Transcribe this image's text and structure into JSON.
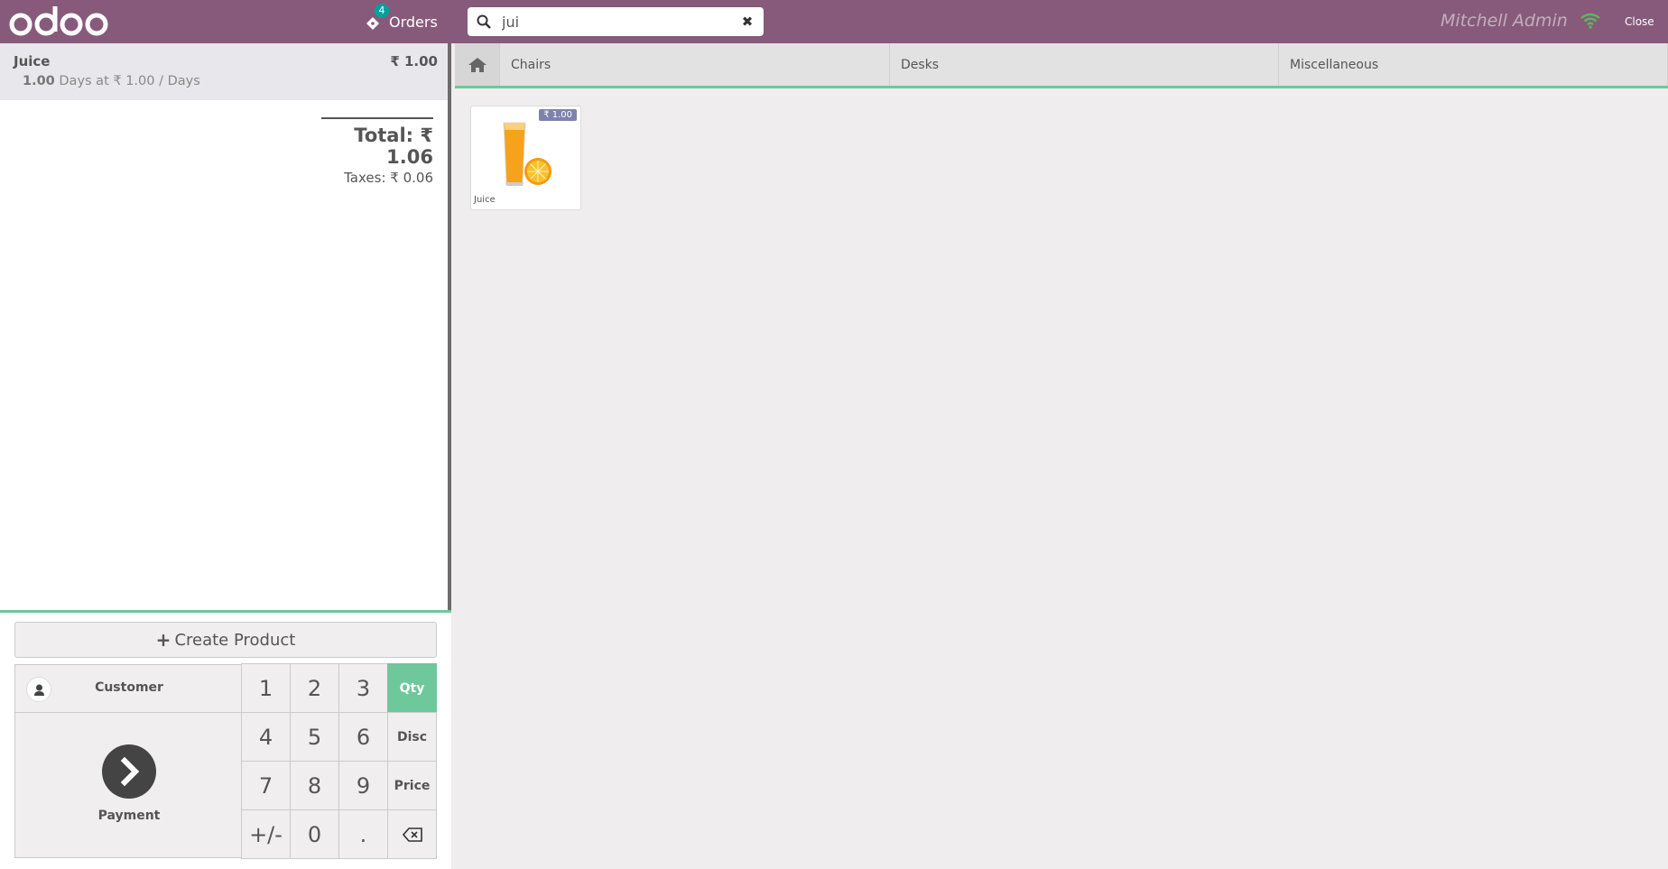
{
  "header": {
    "orders_count": "4",
    "orders_label": "Orders",
    "search_value": "jui",
    "user": "Mitchell Admin",
    "close_label": "Close"
  },
  "order": {
    "lines": [
      {
        "name": "Juice",
        "price": "₹ 1.00",
        "qty": "1.00",
        "unit_text": "Days at ₹ 1.00 / Days"
      }
    ],
    "total": "Total: ₹ 1.06",
    "taxes": "Taxes: ₹ 0.06"
  },
  "controls": {
    "create_product": "Create Product",
    "customer": "Customer",
    "payment": "Payment",
    "keys": [
      "1",
      "2",
      "3",
      "Qty",
      "4",
      "5",
      "6",
      "Disc",
      "7",
      "8",
      "9",
      "Price",
      "+/-",
      "0",
      ".",
      "backspace"
    ],
    "active_mode": "Qty"
  },
  "categories": [
    "Chairs",
    "Desks",
    "Miscellaneous"
  ],
  "products": [
    {
      "name": "Juice",
      "price": "₹ 1.00"
    }
  ],
  "colors": {
    "brand": "#875a7b",
    "accent": "#6ec89b",
    "badge": "#00a09d"
  }
}
